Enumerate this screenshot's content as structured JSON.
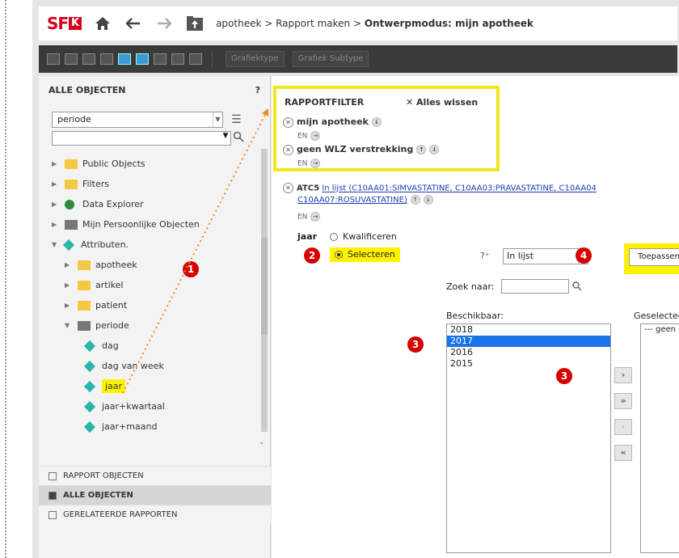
{
  "breadcrumb": {
    "part1": "apotheek",
    "sep1": " > ",
    "part2": "Rapport maken",
    "sep2": " > ",
    "current": "Ontwerpmodus: mijn apotheek"
  },
  "logo": {
    "text": "SF",
    "accent": "K"
  },
  "toolbar": {
    "chart_type_label": "Grafiektype",
    "chart_subtype_label": "Grafiek Subtype"
  },
  "left_panel": {
    "title": "ALLE OBJECTEN",
    "help": "?",
    "filter_select": "periode",
    "tree": [
      {
        "label": "Public Objects",
        "icon": "folder-icon",
        "level": 0
      },
      {
        "label": "Filters",
        "icon": "filter-folder-icon",
        "level": 0
      },
      {
        "label": "Data Explorer",
        "icon": "data-explorer-icon",
        "level": 0
      },
      {
        "label": "Mijn Persoonlijke Objecten",
        "icon": "personal-folder-icon",
        "level": 0
      },
      {
        "label": "Attributen.",
        "icon": "attributes-icon",
        "level": 0
      },
      {
        "label": "apotheek",
        "icon": "folder-icon",
        "level": 1
      },
      {
        "label": "artikel",
        "icon": "folder-icon",
        "level": 1
      },
      {
        "label": "patient",
        "icon": "folder-icon",
        "level": 1
      },
      {
        "label": "periode",
        "icon": "open-folder-icon",
        "level": 1
      },
      {
        "label": "dag",
        "icon": "attribute-icon",
        "level": 2
      },
      {
        "label": "dag van week",
        "icon": "attribute-icon",
        "level": 2
      },
      {
        "label": "jaar",
        "icon": "attribute-icon",
        "level": 2
      },
      {
        "label": "jaar+kwartaal",
        "icon": "attribute-icon",
        "level": 2
      },
      {
        "label": "jaar+maand",
        "icon": "attribute-icon",
        "level": 2
      }
    ],
    "bottom_tabs": [
      "RAPPORT OBJECTEN",
      "ALLE OBJECTEN",
      "GERELATEERDE RAPPORTEN"
    ]
  },
  "report_filter": {
    "title": "RAPPORTFILTER",
    "clear_all": "Alles wissen",
    "filters": [
      {
        "label": "mijn apotheek",
        "conj": "EN"
      },
      {
        "label": "geen WLZ verstrekking",
        "conj": "EN"
      }
    ],
    "atc": {
      "name": "ATC5",
      "link_line1": "In lijst (C10AA01:SIMVASTATINE, C10AA03:PRAVASTATINE, C10AA04",
      "link_line2": "C10AA07:ROSUVASTATINE)",
      "conj": "EN"
    }
  },
  "qualify": {
    "attribute": "jaar",
    "opt_kwalificeren": "Kwalificeren",
    "opt_selecteren": "Selecteren",
    "operator": "In lijst",
    "apply": "Toepassen"
  },
  "selector": {
    "search_label": "Zoek naar:",
    "available_label": "Beschikbaar:",
    "selected_label": "Geselecteer",
    "available": [
      "2018",
      "2017",
      "2016",
      "2015"
    ],
    "selected_index": 1,
    "selected_items": [
      "--- geen ---"
    ]
  },
  "badges": [
    "1",
    "2",
    "3",
    "3",
    "4"
  ],
  "colors": {
    "highlight": "#fff200",
    "brand_red": "#d6001c",
    "badge_red": "#d50000",
    "list_selected": "#1a73e8"
  }
}
